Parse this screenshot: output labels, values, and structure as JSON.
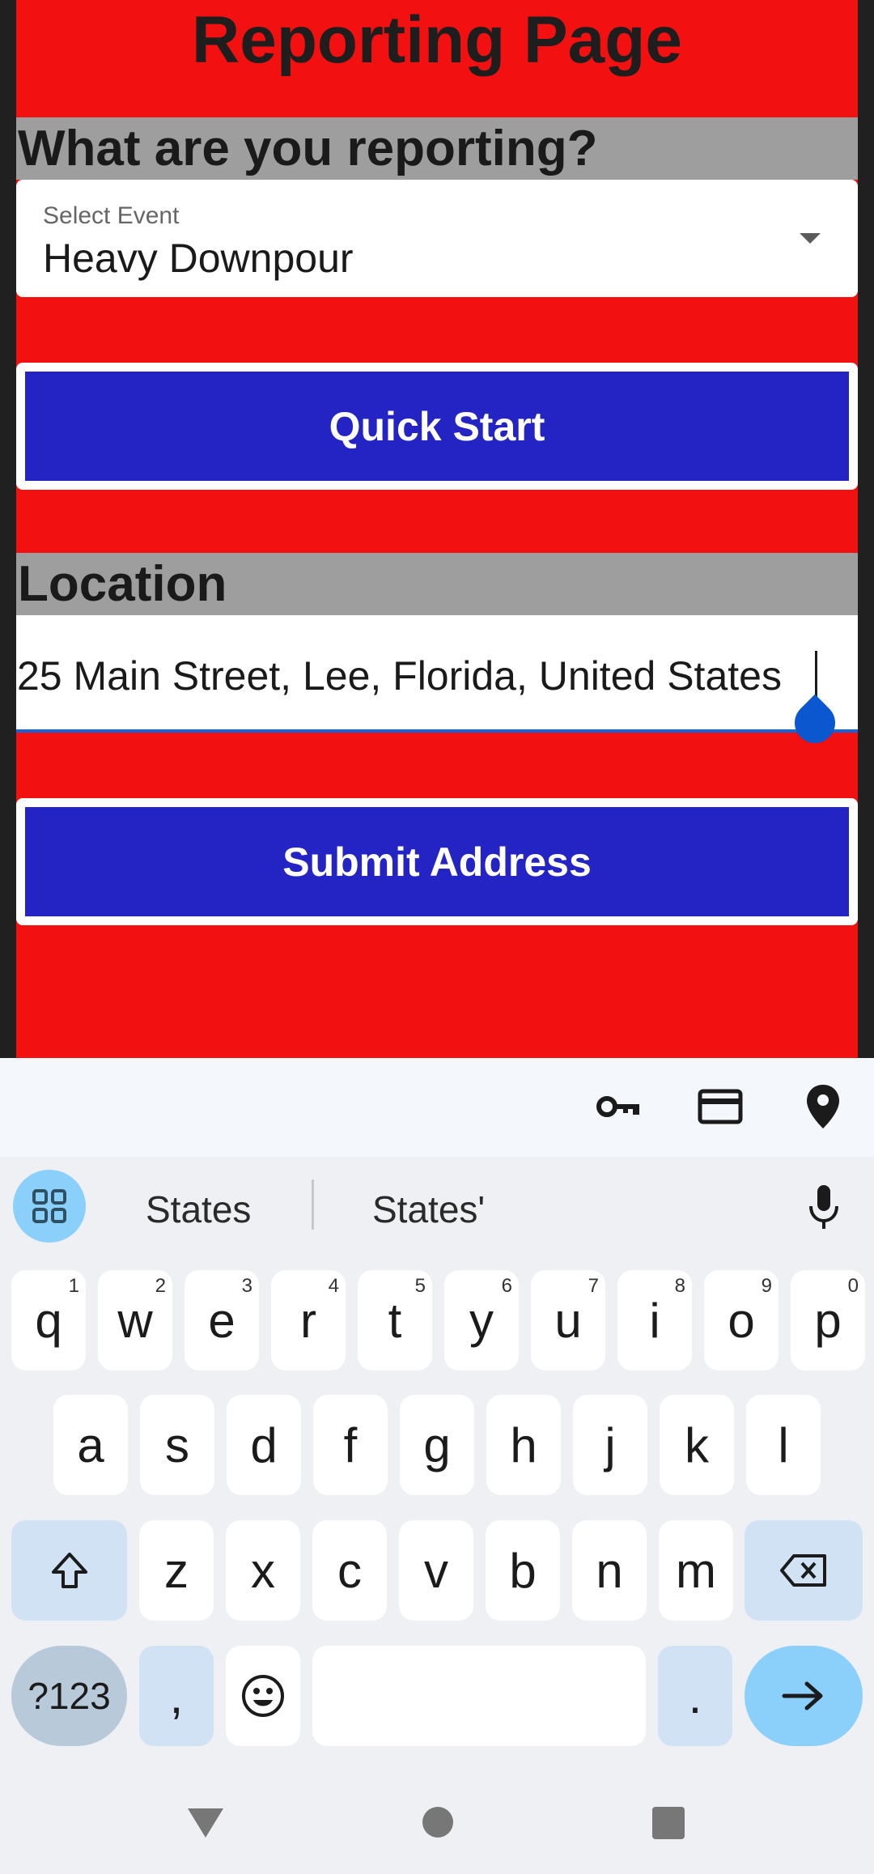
{
  "app": {
    "title": "Reporting Page",
    "event_section_header": "What are you reporting?",
    "event_select": {
      "label": "Select Event",
      "value": "Heavy Downpour"
    },
    "quick_start_label": "Quick Start",
    "location_section_header": "Location",
    "address_value": "25 Main Street, Lee, Florida, United States",
    "submit_label": "Submit Address",
    "colors": {
      "background": "#f21010",
      "button": "#2424c4",
      "header_bar": "#9e9e9e"
    }
  },
  "keyboard": {
    "toolbar_icons": [
      "key-icon",
      "credit-card-icon",
      "location-pin-icon"
    ],
    "suggestions": [
      "States",
      "States'"
    ],
    "row1": [
      {
        "k": "q",
        "sup": "1"
      },
      {
        "k": "w",
        "sup": "2"
      },
      {
        "k": "e",
        "sup": "3"
      },
      {
        "k": "r",
        "sup": "4"
      },
      {
        "k": "t",
        "sup": "5"
      },
      {
        "k": "y",
        "sup": "6"
      },
      {
        "k": "u",
        "sup": "7"
      },
      {
        "k": "i",
        "sup": "8"
      },
      {
        "k": "o",
        "sup": "9"
      },
      {
        "k": "p",
        "sup": "0"
      }
    ],
    "row2": [
      "a",
      "s",
      "d",
      "f",
      "g",
      "h",
      "j",
      "k",
      "l"
    ],
    "row3": [
      "z",
      "x",
      "c",
      "v",
      "b",
      "n",
      "m"
    ],
    "symbols_label": "?123",
    "comma_label": ",",
    "period_label": "."
  }
}
